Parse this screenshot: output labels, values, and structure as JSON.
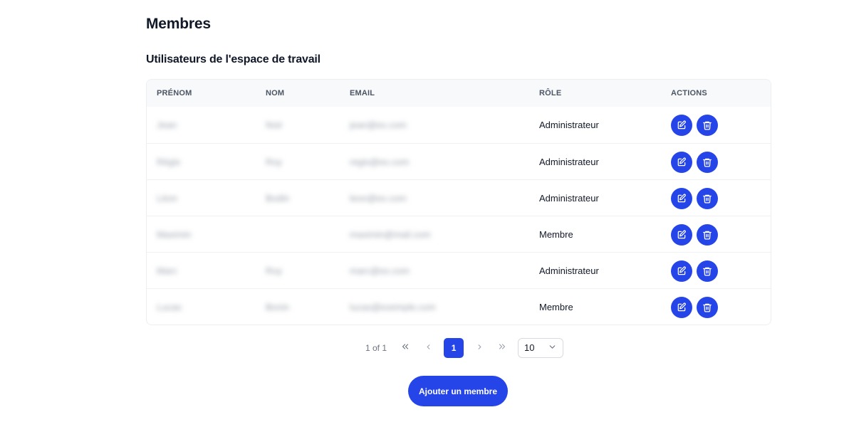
{
  "header": {
    "title": "Membres",
    "subtitle": "Utilisateurs de l'espace de travail"
  },
  "table": {
    "columns": {
      "first_name": "PRÉNOM",
      "last_name": "NOM",
      "email": "EMAIL",
      "role": "RÔLE",
      "actions": "ACTIONS"
    },
    "rows": [
      {
        "first_name": "Jean",
        "last_name": "Noir",
        "email": "jean@ex.com",
        "role": "Administrateur"
      },
      {
        "first_name": "Régis",
        "last_name": "Roy",
        "email": "regis@ex.com",
        "role": "Administrateur"
      },
      {
        "first_name": "Léon",
        "last_name": "Bodin",
        "email": "leon@ex.com",
        "role": "Administrateur"
      },
      {
        "first_name": "Maximin",
        "last_name": "",
        "email": "maximin@mail.com",
        "role": "Membre"
      },
      {
        "first_name": "Marc",
        "last_name": "Roy",
        "email": "marc@ex.com",
        "role": "Administrateur"
      },
      {
        "first_name": "Lucas",
        "last_name": "Bonin",
        "email": "lucas@exemple.com",
        "role": "Membre"
      }
    ]
  },
  "pagination": {
    "page_info": "1 of 1",
    "current_page": "1",
    "page_size": "10"
  },
  "add_member_button": "Ajouter un membre",
  "colors": {
    "accent": "#2545e8",
    "header_bg": "#f8f9fb",
    "text": "#111827"
  },
  "icons": {
    "edit": "edit-icon",
    "delete": "trash-icon",
    "first": "double-chevron-left-icon",
    "prev": "chevron-left-icon",
    "next": "chevron-right-icon",
    "last": "double-chevron-right-icon",
    "dropdown": "chevron-down-icon"
  }
}
